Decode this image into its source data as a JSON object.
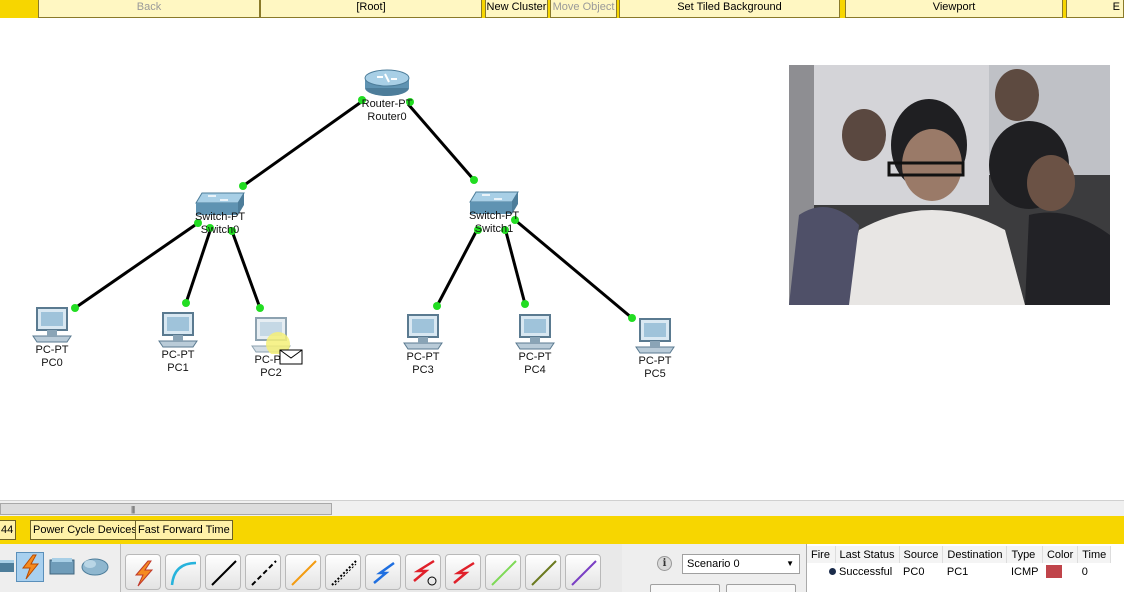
{
  "toolbar": {
    "back": "Back",
    "root": "[Root]",
    "new_cluster": "New Cluster",
    "move_object": "Move Object",
    "set_tiled_background": "Set Tiled Background",
    "viewport": "Viewport",
    "cut_button": "E"
  },
  "devices": {
    "router0": {
      "type": "Router-PT",
      "name": "Router0"
    },
    "switch0": {
      "type": "Switch-PT",
      "name": "Switch0"
    },
    "switch1": {
      "type": "Switch-PT",
      "name": "Switch1"
    },
    "pc0": {
      "type": "PC-PT",
      "name": "PC0"
    },
    "pc1": {
      "type": "PC-PT",
      "name": "PC1"
    },
    "pc2": {
      "type": "PC-PT",
      "name": "PC2"
    },
    "pc3": {
      "type": "PC-PT",
      "name": "PC3"
    },
    "pc4": {
      "type": "PC-PT",
      "name": "PC4"
    },
    "pc5": {
      "type": "PC-PT",
      "name": "PC5"
    }
  },
  "link_color": "#000000",
  "link_status_color": "#22dd22",
  "bottom_bar": {
    "time_label": "44",
    "power_cycle": "Power Cycle Devices",
    "fast_forward": "Fast Forward Time"
  },
  "scenario": {
    "selected": "Scenario 0"
  },
  "pdu_table": {
    "headers": [
      "Fire",
      "Last Status",
      "Source",
      "Destination",
      "Type",
      "Color",
      "Time"
    ],
    "rows": [
      {
        "last_status": "Successful",
        "source": "PC0",
        "destination": "PC1",
        "type": "ICMP",
        "color": "#c0444a",
        "time": "0"
      }
    ]
  },
  "connection_icons": [
    "auto-connect-icon",
    "console-cable-icon",
    "copper-straight-icon",
    "copper-cross-icon",
    "fiber-icon",
    "phone-cable-icon",
    "coaxial-icon",
    "serial-dce-icon",
    "serial-dte-icon",
    "octal-cable-icon",
    "iot-cable-icon",
    "usb-cable-icon"
  ],
  "category_icons": [
    "switches-icon",
    "connections-icon",
    "end-devices-icon",
    "wan-emulation-icon"
  ],
  "accent": "#f7d600"
}
